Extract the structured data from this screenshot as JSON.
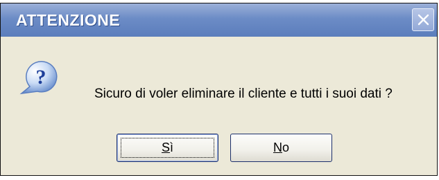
{
  "window": {
    "title": "ATTENZIONE"
  },
  "message": "Sicuro di voler eliminare il cliente e tutti i suoi dati ?",
  "buttons": {
    "yes": {
      "mnemonic": "S",
      "rest": "ì"
    },
    "no": {
      "mnemonic": "N",
      "rest": "o"
    }
  },
  "icons": {
    "dialog": "question-icon",
    "close": "close-icon"
  },
  "colors": {
    "titlebar": "#6c8cc6",
    "body": "#ece9d8",
    "button_border": "#1c2f6b"
  }
}
